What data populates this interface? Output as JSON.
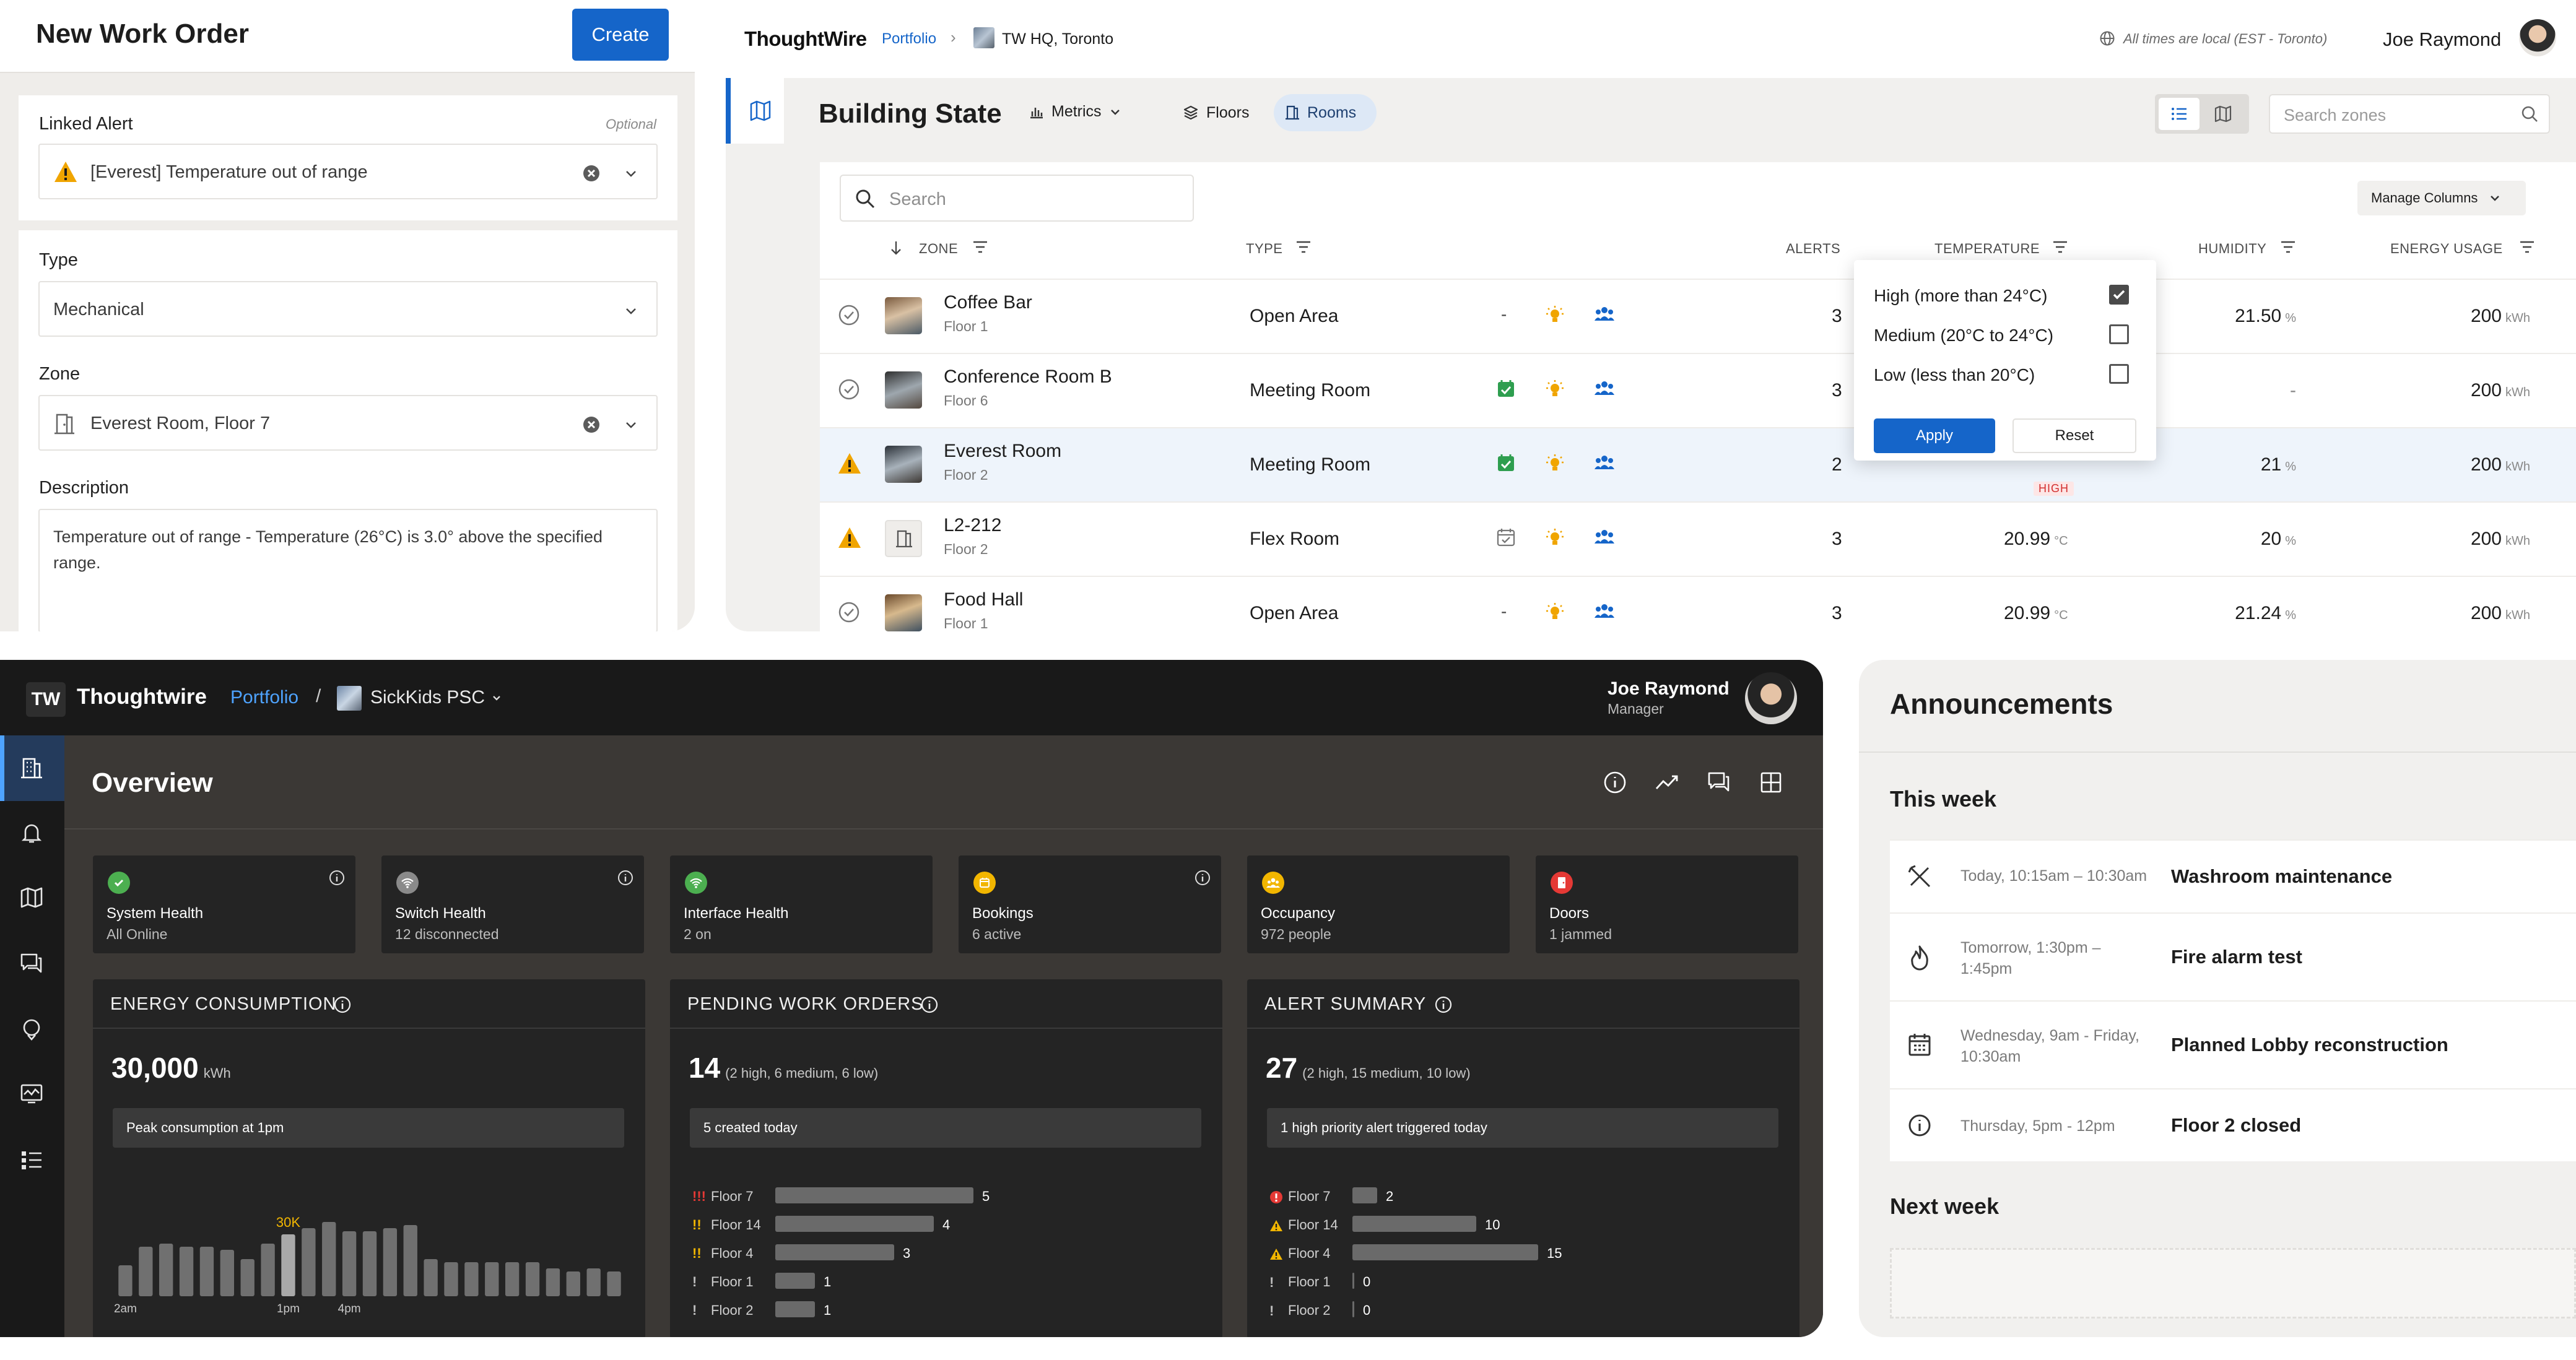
{
  "work_order": {
    "title": "New Work Order",
    "create_label": "Create",
    "linked_alert_label": "Linked Alert",
    "optional_label": "Optional",
    "linked_alert_value": "[Everest] Temperature out of range",
    "type_label": "Type",
    "type_value": "Mechanical",
    "zone_label": "Zone",
    "zone_value": "Everest Room, Floor 7",
    "description_label": "Description",
    "description_value": "Temperature out of range - Temperature (26°C) is 3.0° above the specified range."
  },
  "building_state": {
    "brand": "ThoughtWire",
    "breadcrumb": {
      "portfolio": "Portfolio",
      "building": "TW HQ, Toronto"
    },
    "timezone_note": "All times are local (EST - Toronto)",
    "user_name": "Joe Raymond",
    "title": "Building State",
    "metrics_label": "Metrics",
    "floors_label": "Floors",
    "rooms_label": "Rooms",
    "search_zones_placeholder": "Search zones",
    "table_search_placeholder": "Search",
    "manage_columns_label": "Manage Columns",
    "columns": {
      "zone": "ZONE",
      "type": "TYPE",
      "alerts": "ALERTS",
      "temperature": "TEMPERATURE",
      "humidity": "HUMIDITY",
      "energy": "ENERGY USAGE"
    },
    "units": {
      "temp": "°C",
      "humidity": "%",
      "energy": "kWh"
    },
    "high_badge": "HIGH",
    "rows": [
      {
        "zone": "Coffee Bar",
        "floor": "Floor 1",
        "type": "Open Area",
        "alerts": "3",
        "temperature": "",
        "humidity": "21.50",
        "energy": "200"
      },
      {
        "zone": "Conference Room B",
        "floor": "Floor 6",
        "type": "Meeting Room",
        "alerts": "3",
        "temperature": "",
        "humidity": "-",
        "energy": "200"
      },
      {
        "zone": "Everest Room",
        "floor": "Floor 2",
        "type": "Meeting Room",
        "alerts": "2",
        "temperature": "",
        "humidity": "21",
        "energy": "200"
      },
      {
        "zone": "L2-212",
        "floor": "Floor 2",
        "type": "Flex Room",
        "alerts": "3",
        "temperature": "20.99",
        "humidity": "20",
        "energy": "200"
      },
      {
        "zone": "Food Hall",
        "floor": "Floor 1",
        "type": "Open Area",
        "alerts": "3",
        "temperature": "20.99",
        "humidity": "21.24",
        "energy": "200"
      }
    ],
    "filter_popup": {
      "options": [
        {
          "label": "High (more than 24°C)",
          "checked": true
        },
        {
          "label": "Medium (20°C to 24°C)",
          "checked": false
        },
        {
          "label": "Low (less than 20°C)",
          "checked": false
        }
      ],
      "apply_label": "Apply",
      "reset_label": "Reset"
    }
  },
  "overview": {
    "brand": "Thoughtwire",
    "logo_text": "TW",
    "breadcrumb": {
      "portfolio": "Portfolio",
      "separator": "/",
      "site": "SickKids PSC"
    },
    "user_name": "Joe Raymond",
    "user_role": "Manager",
    "title": "Overview",
    "status_cards": [
      {
        "title": "System Health",
        "sub": "All Online",
        "color": "#4caf50",
        "icon": "check-icon"
      },
      {
        "title": "Switch Health",
        "sub": "12 disconnected",
        "color": "#8a8a8a",
        "icon": "wifi-icon"
      },
      {
        "title": "Interface Health",
        "sub": "2 on",
        "color": "#4caf50",
        "icon": "wifi-icon"
      },
      {
        "title": "Bookings",
        "sub": "6 active",
        "color": "#f2b600",
        "icon": "calendar-icon"
      },
      {
        "title": "Occupancy",
        "sub": "972 people",
        "color": "#f2b600",
        "icon": "people-icon"
      },
      {
        "title": "Doors",
        "sub": "1 jammed",
        "color": "#e53935",
        "icon": "door-icon"
      }
    ],
    "energy": {
      "title": "ENERGY CONSUMPTION",
      "value": "30,000",
      "unit": "kWh",
      "note": "Peak consumption at 1pm",
      "peak_label": "30K",
      "x_labels": [
        "2am",
        "1pm",
        "4pm"
      ]
    },
    "pending": {
      "title": "PENDING WORK ORDERS",
      "value": "14",
      "sub": "(2 high, 6 medium, 6 low)",
      "note": "5 created today",
      "rows": [
        {
          "mark": "!!!",
          "label": "Floor 7",
          "value": 5
        },
        {
          "mark": "!!",
          "label": "Floor 14",
          "value": 4
        },
        {
          "mark": "!!",
          "label": "Floor 4",
          "value": 3
        },
        {
          "mark": "!",
          "label": "Floor 1",
          "value": 1
        },
        {
          "mark": "!",
          "label": "Floor 2",
          "value": 1
        }
      ]
    },
    "alerts": {
      "title": "ALERT SUMMARY",
      "value": "27",
      "sub": "(2 high, 15 medium, 10 low)",
      "note": "1 high priority alert triggered today",
      "rows": [
        {
          "label": "Floor 7",
          "value": 2
        },
        {
          "label": "Floor 14",
          "value": 10
        },
        {
          "label": "Floor 4",
          "value": 15
        },
        {
          "label": "Floor 1",
          "value": 0
        },
        {
          "label": "Floor 2",
          "value": 0
        }
      ]
    }
  },
  "chart_data": {
    "type": "bar",
    "title": "ENERGY CONSUMPTION",
    "x_tick_labels": [
      "2am",
      "1pm",
      "4pm"
    ],
    "values": [
      10,
      16,
      17,
      16,
      16,
      15,
      12,
      17,
      20,
      22,
      24,
      21,
      21,
      22,
      23,
      12,
      11,
      11,
      11,
      11,
      11,
      9,
      8,
      9,
      8
    ],
    "highlight_index": 8,
    "peak_label": "30K",
    "ylim": [
      0,
      30
    ]
  },
  "announcements": {
    "title": "Announcements",
    "this_week_label": "This week",
    "items": [
      {
        "when": "Today, 10:15am – 10:30am",
        "title": "Washroom maintenance",
        "icon": "tools-icon"
      },
      {
        "when": "Tomorrow, 1:30pm – 1:45pm",
        "title": "Fire alarm test",
        "icon": "flame-icon"
      },
      {
        "when": "Wednesday, 9am - Friday, 10:30am",
        "title": "Planned Lobby reconstruction",
        "icon": "calendar-icon"
      },
      {
        "when": "Thursday, 5pm - 12pm",
        "title": "Floor 2 closed",
        "icon": "info-icon"
      }
    ],
    "next_week_label": "Next week"
  }
}
